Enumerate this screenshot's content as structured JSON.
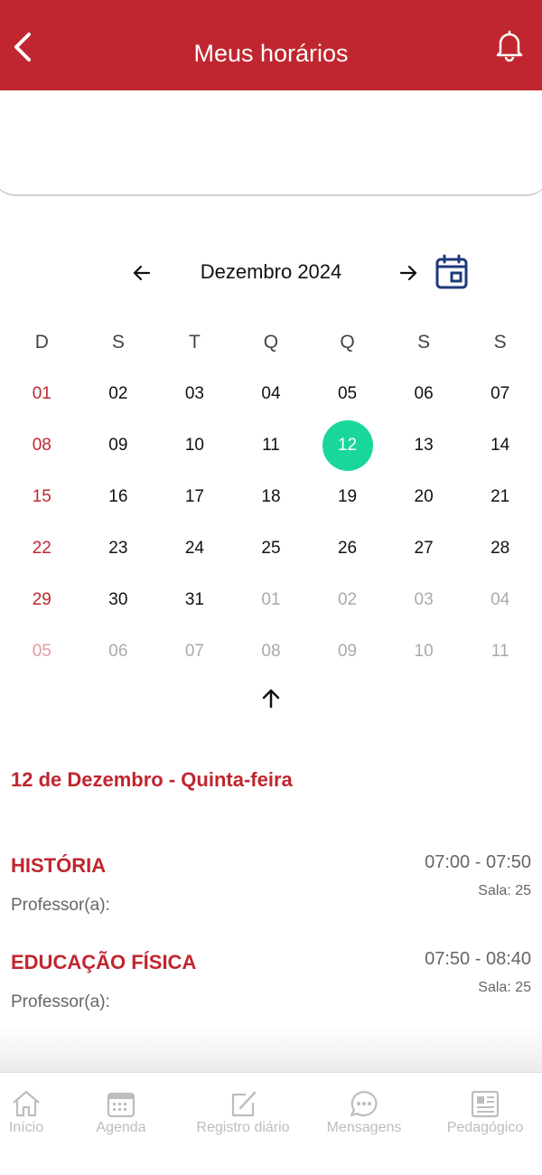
{
  "header": {
    "title": "Meus horários"
  },
  "calendar": {
    "month_label": "Dezembro 2024",
    "weekdays": [
      "D",
      "S",
      "T",
      "Q",
      "Q",
      "S",
      "S"
    ],
    "weeks": [
      [
        "01",
        "02",
        "03",
        "04",
        "05",
        "06",
        "07"
      ],
      [
        "08",
        "09",
        "10",
        "11",
        "12",
        "13",
        "14"
      ],
      [
        "15",
        "16",
        "17",
        "18",
        "19",
        "20",
        "21"
      ],
      [
        "22",
        "23",
        "24",
        "25",
        "26",
        "27",
        "28"
      ],
      [
        "29",
        "30",
        "31",
        "01",
        "02",
        "03",
        "04"
      ],
      [
        "05",
        "06",
        "07",
        "08",
        "09",
        "10",
        "11"
      ]
    ],
    "selected_day": "12",
    "colors": {
      "sunday": "#c0262f",
      "selected": "#19d79c",
      "outside_month": "#aaaaaa"
    }
  },
  "schedule": {
    "date_heading": "12 de Dezembro - Quinta-feira",
    "lessons": [
      {
        "subject": "HISTÓRIA",
        "time": "07:00 - 07:50",
        "room": "Sala: 25",
        "teacher": "Professor(a):"
      },
      {
        "subject": "EDUCAÇÃO FÍSICA",
        "time": "07:50 - 08:40",
        "room": "Sala: 25",
        "teacher": "Professor(a):"
      }
    ]
  },
  "nav": {
    "items": [
      {
        "label": "Início",
        "icon": "home-icon"
      },
      {
        "label": "Agenda",
        "icon": "calendar-icon"
      },
      {
        "label": "Registro diário",
        "icon": "edit-icon"
      },
      {
        "label": "Mensagens",
        "icon": "chat-icon"
      },
      {
        "label": "Pedagógico",
        "icon": "newspaper-icon"
      }
    ]
  },
  "colors": {
    "brand": "#c0262f",
    "accent": "#19d79c",
    "icon_blue": "#1f3a7a"
  }
}
